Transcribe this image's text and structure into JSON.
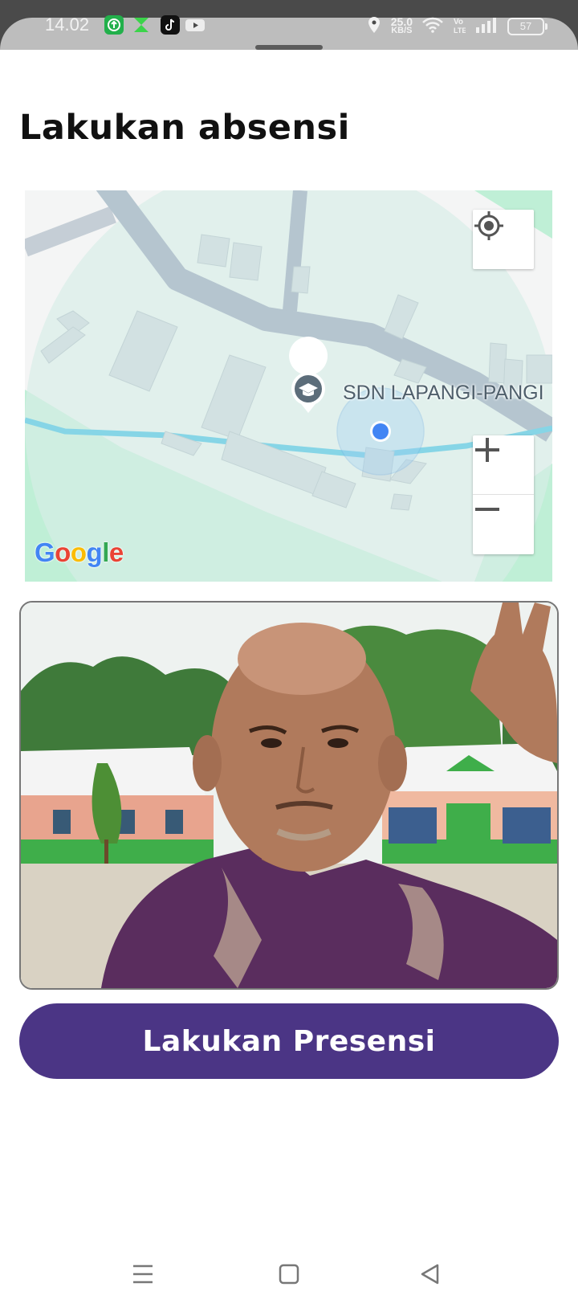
{
  "status_bar": {
    "time": "14.02",
    "net_speed_value": "25.0",
    "net_speed_unit": "KB/S",
    "battery": "57",
    "icons": [
      "app-update-icon",
      "fax-app-icon",
      "tiktok-icon",
      "youtube-icon",
      "location-icon",
      "wifi-icon",
      "volte-icon",
      "signal-icon",
      "battery-icon"
    ]
  },
  "page": {
    "title": "Lakukan absensi"
  },
  "map": {
    "poi_label": "SDN LAPANGI-PANGI",
    "attribution": "Google",
    "controls": {
      "locate": "my-location-icon",
      "zoom_in": "plus-icon",
      "zoom_out": "minus-icon"
    }
  },
  "photo": {
    "subject": "selfie-photo"
  },
  "action": {
    "button_label": "Lakukan Presensi",
    "color": "#4b3585"
  },
  "nav": {
    "recents": "menu-icon",
    "home": "home-square-icon",
    "back": "back-triangle-icon"
  }
}
